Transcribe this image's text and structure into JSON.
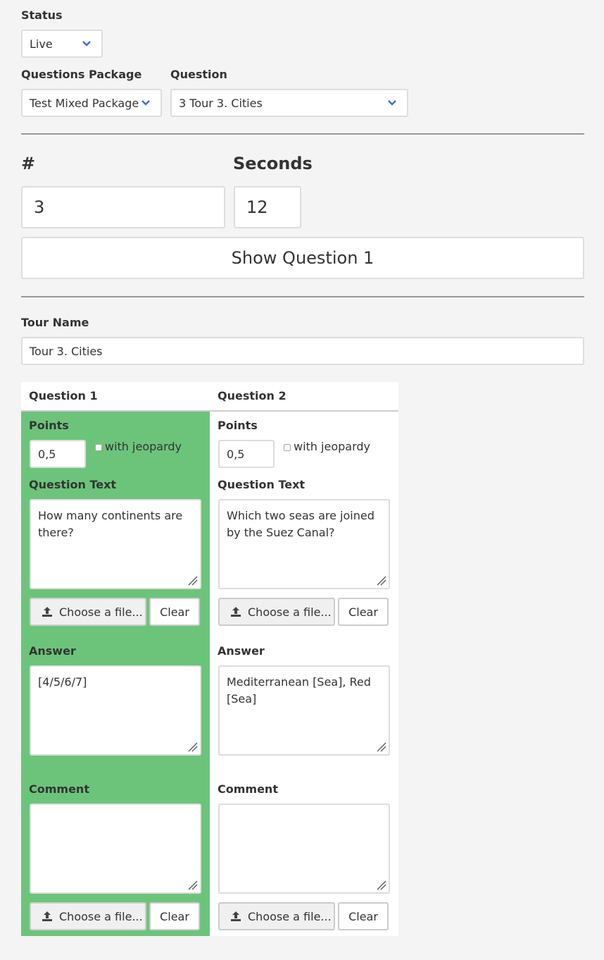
{
  "status": {
    "label": "Status",
    "value": "Live"
  },
  "package": {
    "label": "Questions Package",
    "value": "Test Mixed Package"
  },
  "question_select": {
    "label": "Question",
    "value": "3 Tour 3. Cities"
  },
  "number": {
    "label": "#",
    "value": "3"
  },
  "seconds": {
    "label": "Seconds",
    "value": "12"
  },
  "show_button": "Show Question 1",
  "tour_name": {
    "label": "Tour Name",
    "value": "Tour 3. Cities"
  },
  "questions": [
    {
      "heading": "Question 1",
      "points_label": "Points",
      "points": "0,5",
      "jeopardy_label": "with jeopardy",
      "text_label": "Question Text",
      "text": "How many continents are there?",
      "choose_file": "Choose a file...",
      "clear": "Clear",
      "answer_label": "Answer",
      "answer": "[4/5/6/7]",
      "comment_label": "Comment",
      "comment": "",
      "bg_color": "#6cc47b"
    },
    {
      "heading": "Question 2",
      "points_label": "Points",
      "points": "0,5",
      "jeopardy_label": "with jeopardy",
      "text_label": "Question Text",
      "text": "Which two seas are joined by the Suez Canal?",
      "choose_file": "Choose a file...",
      "clear": "Clear",
      "answer_label": "Answer",
      "answer": "Mediterranean [Sea],  Red [Sea]",
      "comment_label": "Comment",
      "comment": "",
      "bg_color": "#ffffff"
    }
  ],
  "icons": {
    "chevron": "chevron-down-icon",
    "upload": "upload-icon",
    "resize": "resize-grip-icon"
  },
  "colors": {
    "accent_green": "#6cc47b",
    "chevron_blue": "#3a6fd8"
  }
}
